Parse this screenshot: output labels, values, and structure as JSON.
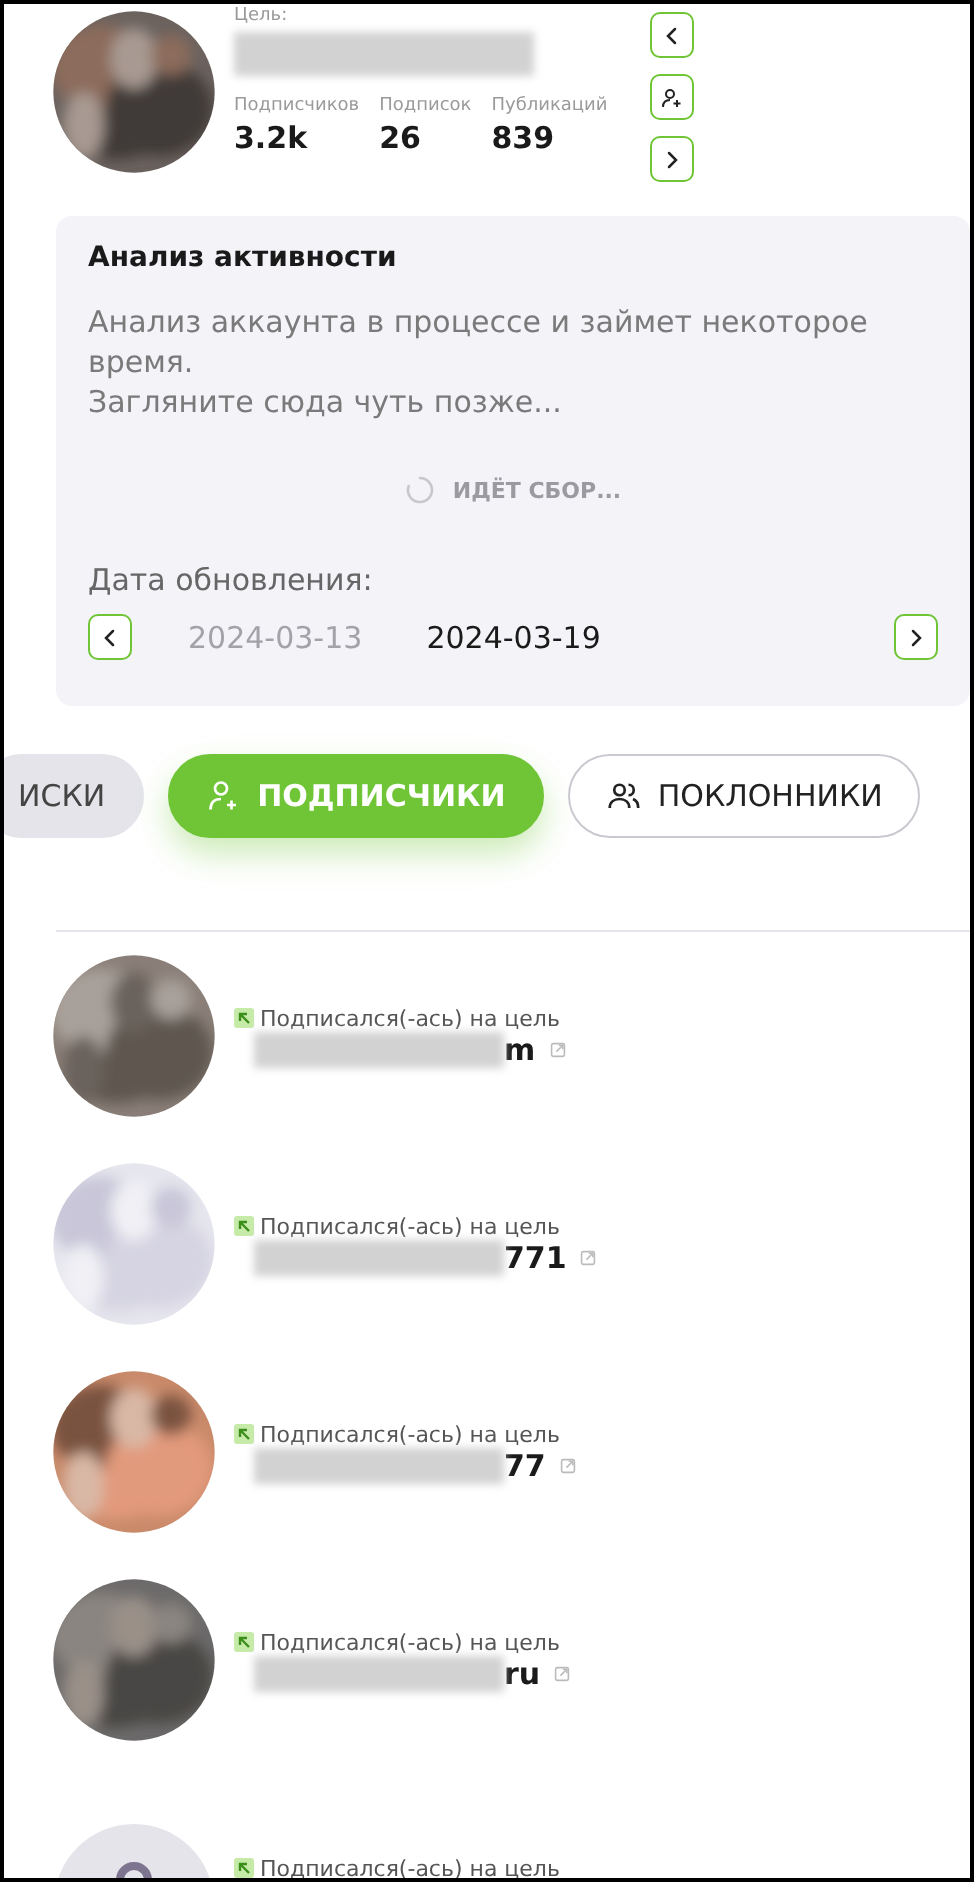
{
  "profile": {
    "label": "Цель:",
    "stats": [
      {
        "label": "Подписчиков",
        "value": "3.2k"
      },
      {
        "label": "Подписок",
        "value": "26"
      },
      {
        "label": "Публикаций",
        "value": "839"
      }
    ],
    "side_buttons": [
      {
        "kind": "prev"
      },
      {
        "kind": "follow"
      },
      {
        "kind": "next"
      }
    ]
  },
  "analysis": {
    "title": "Анализ активности",
    "message": [
      "Анализ аккаунта в процессе и займет некоторое время.",
      "Загляните сюда чуть позже..."
    ],
    "status": "ИДЁТ СБОР...",
    "date_label": "Дата обновления:",
    "dates": [
      {
        "text": "2024-03-13",
        "selected": false
      },
      {
        "text": "2024-03-19",
        "selected": true
      }
    ]
  },
  "tabs": [
    {
      "label": "ИСКИ",
      "kind": "plain",
      "selected": false
    },
    {
      "label": "ПОДПИСЧИКИ",
      "kind": "follow",
      "selected": true
    },
    {
      "label": "ПОКЛОННИКИ",
      "kind": "group",
      "selected": false
    }
  ],
  "followers": [
    {
      "status": "Подписался(-ась) на цель",
      "name": "m",
      "kind": "picture"
    },
    {
      "status": "Подписался(-ась) на цель",
      "name": "771",
      "kind": "picture"
    },
    {
      "status": "Подписался(-ась) на цель",
      "name": "77",
      "kind": "picture"
    },
    {
      "status": "Подписался(-ась) на цель",
      "name": "ru",
      "kind": "picture"
    },
    {
      "status": "Подписался(-ась) на цель",
      "kind": "placeholder"
    }
  ]
}
